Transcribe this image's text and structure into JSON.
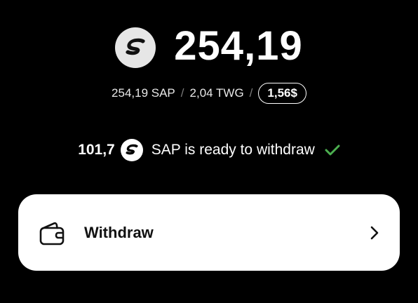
{
  "balance": {
    "coin_icon": "sap-coin-icon",
    "amount": "254,19"
  },
  "breakdown": {
    "sap": "254,19 SAP",
    "separator_1": "/",
    "twg": "2,04 TWG",
    "separator_2": "/",
    "usd": "1,56$"
  },
  "ready": {
    "amount": "101,7",
    "coin_icon": "sap-coin-icon",
    "text": "SAP is ready to withdraw",
    "check_icon": "check-icon",
    "check_color": "#4caf50"
  },
  "withdraw": {
    "icon": "wallet-icon",
    "label": "Withdraw",
    "chevron_icon": "chevron-right-icon"
  },
  "colors": {
    "background": "#000000",
    "card": "#ffffff",
    "coin_bg": "#e6e6e6"
  }
}
